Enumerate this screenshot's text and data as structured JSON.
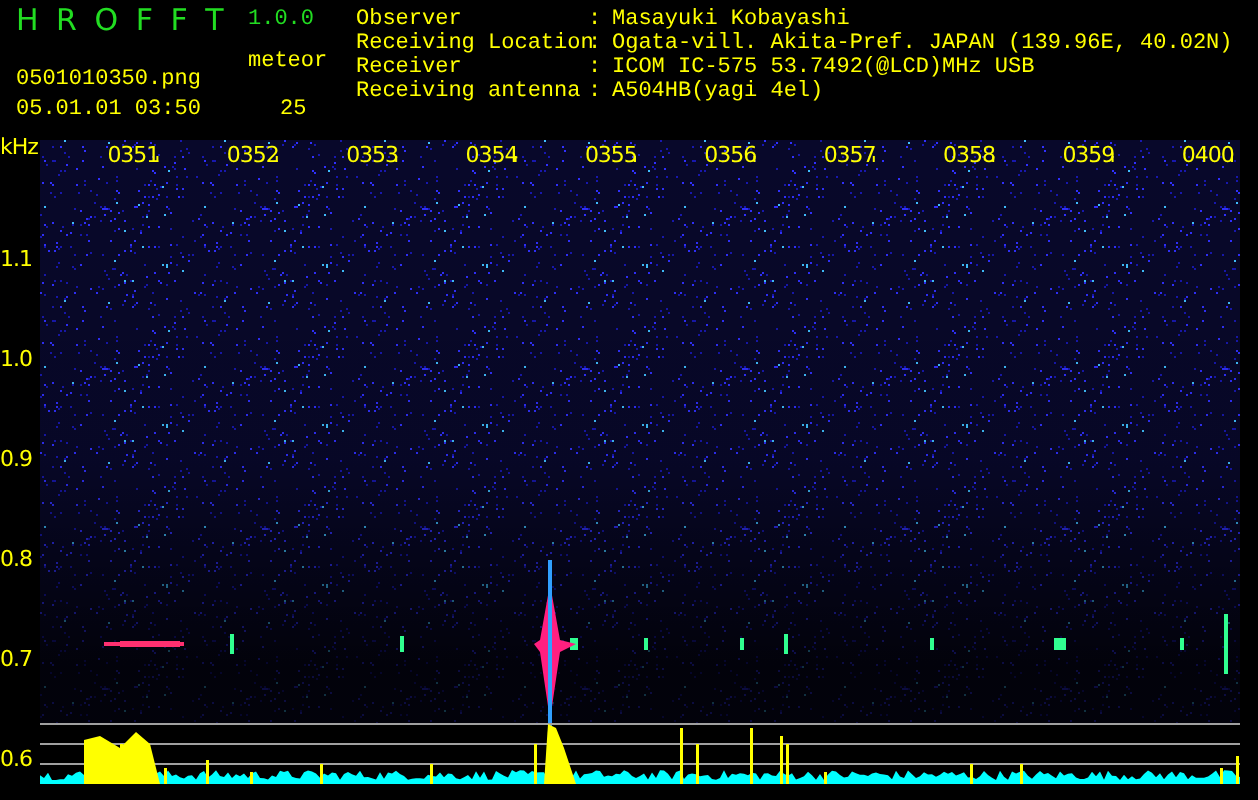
{
  "app": {
    "title": "H R O F F T",
    "version": "1.0.0"
  },
  "capture": {
    "file": "0501010350.png",
    "datetime": "05.01.01 03:50",
    "counter_label": "meteor",
    "counter_value": "25"
  },
  "info": [
    {
      "label": "Observer",
      "separator": ":",
      "value": "Masayuki Kobayashi"
    },
    {
      "label": "Receiving Location",
      "separator": ":",
      "value": "Ogata-vill. Akita-Pref. JAPAN (139.96E, 40.02N)"
    },
    {
      "label": "Receiver",
      "separator": ":",
      "value": "ICOM IC-575 53.7492(@LCD)MHz USB"
    },
    {
      "label": "Receiving antenna",
      "separator": ":",
      "value": "A504HB(yagi 4el)"
    }
  ],
  "plot": {
    "unit": "kHz",
    "frequency_labels": [
      "1.1",
      "1.0",
      "0.9",
      "0.8",
      "0.7",
      "0.6"
    ],
    "time_labels": [
      "0351",
      "0352",
      "0353",
      "0354",
      "0355",
      "0356",
      "0357",
      "0358",
      "0359",
      "0400"
    ]
  }
}
